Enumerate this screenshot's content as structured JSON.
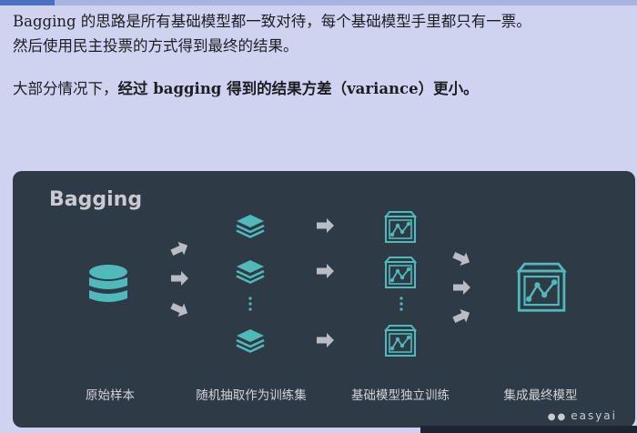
{
  "text": {
    "line1": "Bagging 的思路是所有基础模型都一致对待，每个基础模型手里都只有一票。",
    "line2": "然后使用民主投票的方式得到最终的结果。",
    "line3_prefix": "大部分情况下，",
    "line3_bold": "经过 bagging 得到的结果方差（variance）更小。"
  },
  "diagram": {
    "title": "Bagging",
    "stages": [
      "原始样本",
      "随机抽取作为训练集",
      "基础模型独立训练",
      "集成最终模型"
    ],
    "brand": "easyai",
    "colors": {
      "panel_bg": "#2f3a47",
      "accent": "#4fbab9",
      "arrow": "#b8bcc4",
      "text": "#d0d4da"
    }
  }
}
